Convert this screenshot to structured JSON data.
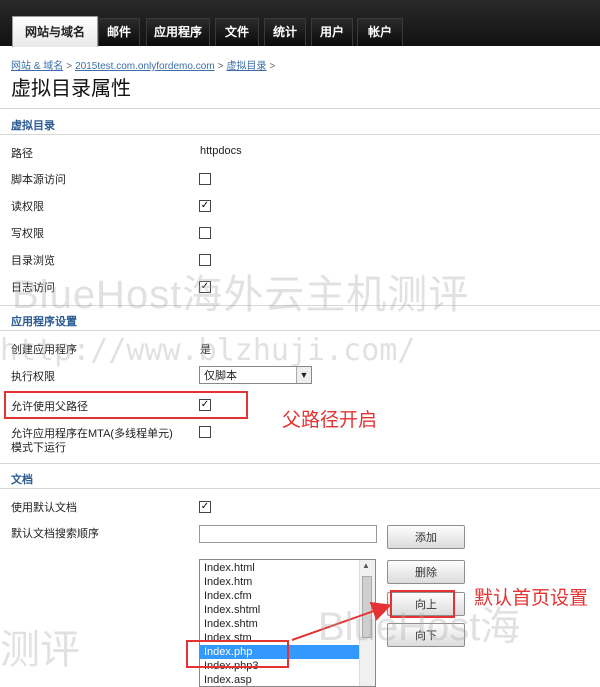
{
  "nav": {
    "tabs": [
      "网站与域名",
      "邮件",
      "应用程序",
      "文件",
      "统计",
      "用户",
      "帐户"
    ],
    "active_index": 0
  },
  "breadcrumb": [
    "网站 & 域名",
    "2015test.com.onlyfordemo.com",
    "虚拟目录"
  ],
  "page_title": "虚拟目录属性",
  "sections": {
    "virtual_dir": "虚拟目录",
    "app_settings": "应用程序设置",
    "documents": "文档"
  },
  "fields": {
    "path_label": "路径",
    "path_value": "httpdocs",
    "script_source_label": "脚本源访问",
    "script_source_checked": false,
    "read_label": "读权限",
    "read_checked": true,
    "write_label": "写权限",
    "write_checked": false,
    "dir_browse_label": "目录浏览",
    "dir_browse_checked": false,
    "log_label": "日志访问",
    "log_checked": true,
    "create_app_label": "创建应用程序",
    "create_app_value": "是",
    "exec_perm_label": "执行权限",
    "exec_perm_value": "仅脚本",
    "allow_parent_label": "允许使用父路径",
    "allow_parent_checked": true,
    "allow_mta_label_line1": "允许应用程序在MTA(多线程单元)",
    "allow_mta_label_line2": "模式下运行",
    "allow_mta_checked": false,
    "use_default_doc_label": "使用默认文档",
    "use_default_doc_checked": true,
    "default_doc_order_label": "默认文档搜索顺序",
    "default_doc_input_value": ""
  },
  "buttons": {
    "add": "添加",
    "delete": "删除",
    "up": "向上",
    "down": "向下"
  },
  "doc_list": {
    "items": [
      "Index.html",
      "Index.htm",
      "Index.cfm",
      "Index.shtml",
      "Index.shtm",
      "Index.stm",
      "Index.php",
      "Index.php3",
      "Index.asp"
    ],
    "selected": "Index.php"
  },
  "annotations": {
    "parent_path_on": "父路径开启",
    "default_home_setting": "默认首页设置"
  },
  "watermarks": {
    "brand": "BlueHost海外云主机测评",
    "url": "http://www.blzhuji.com/",
    "bottom_left": "测评",
    "bottom_right": "BlueHost海"
  },
  "colors": {
    "accent_link": "#3b6ea8",
    "section_heading": "#2c5c94",
    "annotation_red": "#e53333",
    "list_selection": "#3399ff"
  }
}
